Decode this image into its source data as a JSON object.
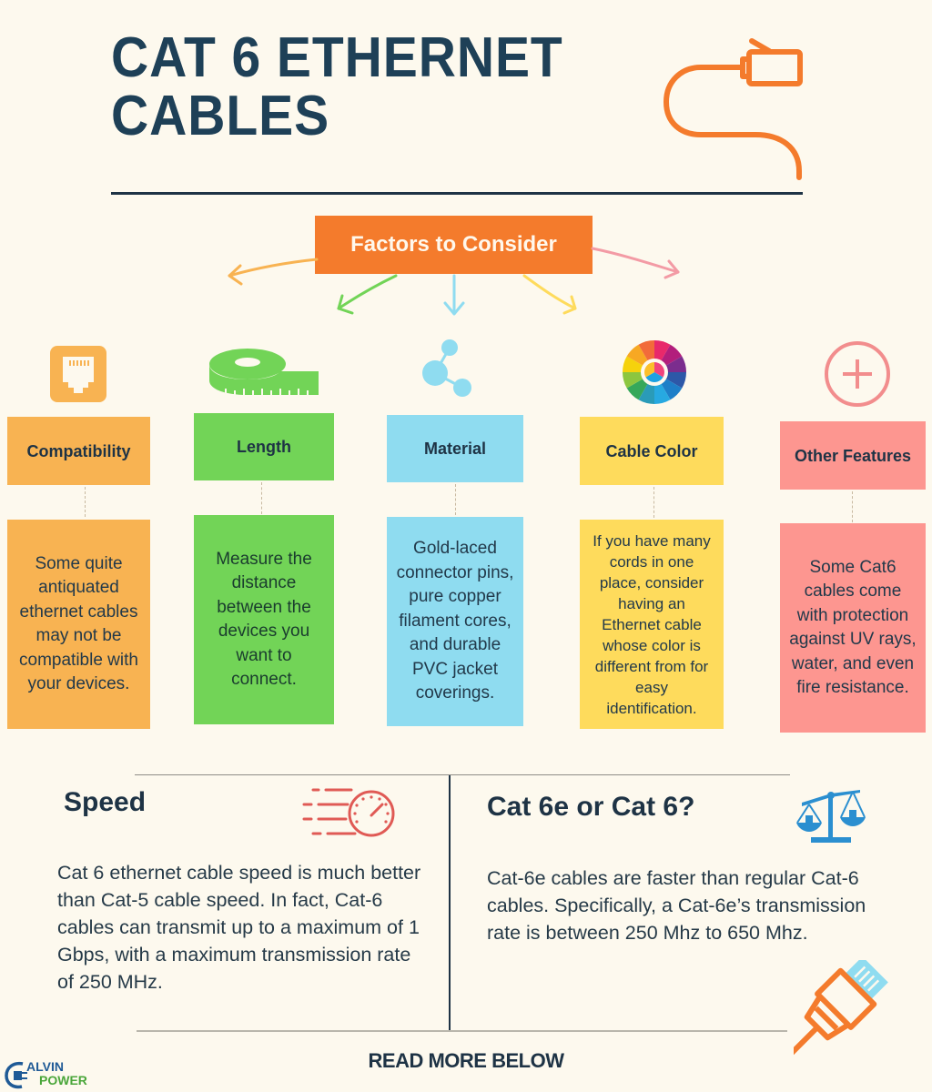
{
  "header": {
    "title_line1": "CAT 6 ETHERNET",
    "title_line2": "CABLES",
    "icon": "ethernet-cable-icon"
  },
  "factors_heading": "Factors to Consider",
  "colors": {
    "background": "#fdf9ee",
    "navy": "#1e3345",
    "orange": "#f47b2c",
    "compatibility": "#f8b352",
    "length": "#72d457",
    "material": "#8fdcf0",
    "cable_color": "#fedb5c",
    "other_features": "#fd9690"
  },
  "factors": [
    {
      "label": "Compatibility",
      "icon": "ethernet-port-icon",
      "description": "Some quite antiquated ethernet cables may not be compatible with your devices."
    },
    {
      "label": "Length",
      "icon": "measuring-tape-icon",
      "description": "Measure the distance between the devices you want to connect."
    },
    {
      "label": "Material",
      "icon": "molecule-icon",
      "description": "Gold-laced connector pins, pure copper filament cores, and durable PVC jacket coverings."
    },
    {
      "label": "Cable Color",
      "icon": "color-wheel-icon",
      "description": "If you have many cords in one place, consider having an Ethernet cable whose color is different from for easy identification."
    },
    {
      "label": "Other Features",
      "icon": "plus-circle-icon",
      "description": "Some Cat6 cables come with protection against UV rays, water, and even fire resistance."
    }
  ],
  "speed": {
    "title": "Speed",
    "icon": "speedometer-icon",
    "body": "Cat 6 ethernet cable speed is much better than Cat-5 cable speed. In fact, Cat-6 cables can transmit up to a maximum of 1 Gbps, with a maximum transmission rate of 250 MHz."
  },
  "comparison": {
    "title": "Cat 6e or Cat 6?",
    "icon": "balance-scale-icon",
    "body": "Cat-6e cables are faster than regular Cat-6 cables. Specifically, a Cat-6e’s transmission rate is between 250 Mhz to 650 Mhz."
  },
  "footer": {
    "read_more": "READ MORE BELOW",
    "logo_line1": "ALVIN",
    "logo_line2": "POWER",
    "corner_icon": "ethernet-plug-icon"
  }
}
